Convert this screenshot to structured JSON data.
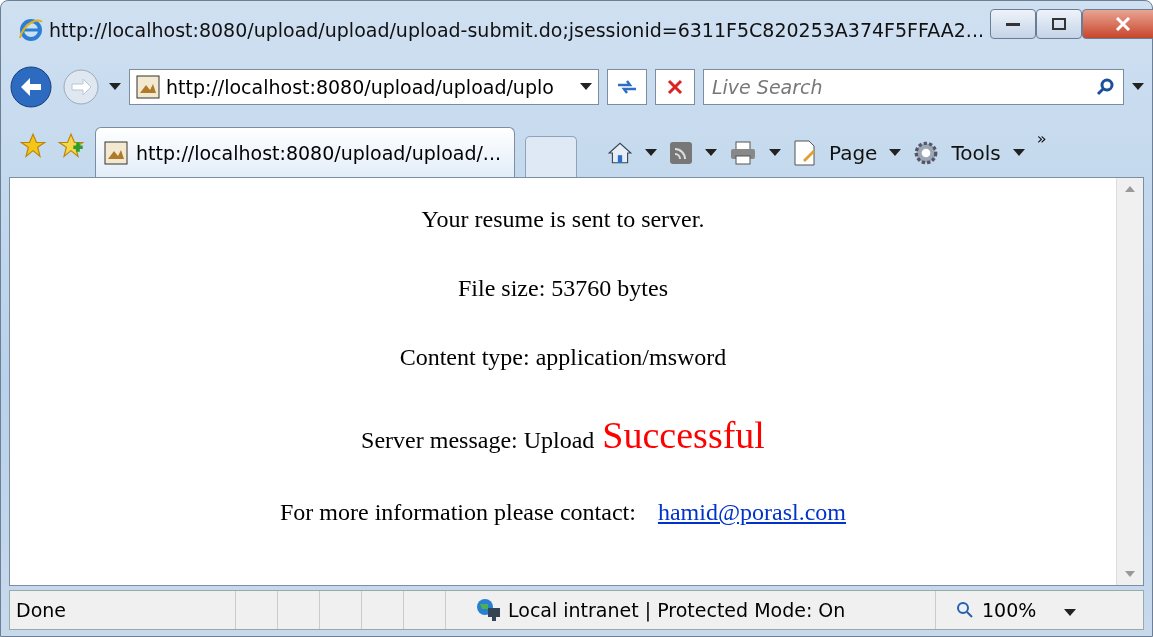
{
  "window": {
    "title": "http://localhost:8080/upload/upload/upload-submit.do;jsessionid=6311F5C820253A374F5FFAA2..."
  },
  "address_bar": {
    "value": "http://localhost:8080/upload/upload/uplo"
  },
  "search": {
    "placeholder": "Live Search"
  },
  "tab": {
    "label": "http://localhost:8080/upload/upload/...",
    "selected": true
  },
  "command_bar": {
    "page": "Page",
    "tools": "Tools",
    "more": "»"
  },
  "content": {
    "lines": [
      "Your resume is sent to server.",
      "File size: 53760 bytes",
      "Content type: application/msword"
    ],
    "message": {
      "label": "Server message: Upload",
      "status": "Successful"
    },
    "contact": {
      "label": "For more information please contact:",
      "link": "hamid@porasl.com"
    }
  },
  "status_bar": {
    "status": "Done",
    "zone": "Local intranet | Protected Mode: On",
    "zoom": "100%"
  }
}
